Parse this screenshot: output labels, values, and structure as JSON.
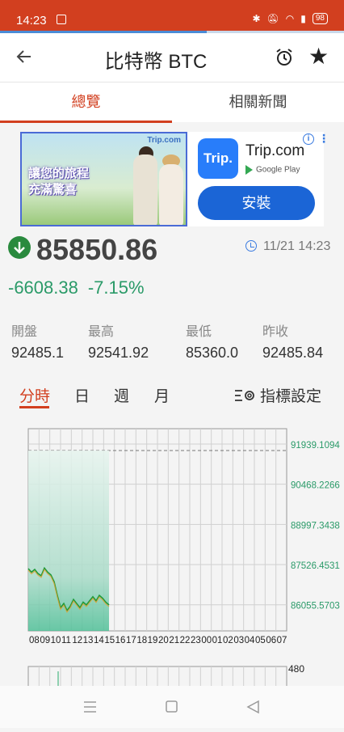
{
  "status_bar": {
    "time": "14:23",
    "battery": "98"
  },
  "header": {
    "title": "比特幣 BTC"
  },
  "tabs": [
    {
      "label": "總覽"
    },
    {
      "label": "相關新聞"
    }
  ],
  "ad": {
    "banner_brand": "Trip.com",
    "banner_headline": "讓您的旅程 充滿驚喜",
    "logo_text": "Trip.",
    "advertiser": "Trip.com",
    "store": "Google Play",
    "install_label": "安裝"
  },
  "quote": {
    "price": "85850.86",
    "datetime": "11/21 14:23",
    "change": "-6608.38",
    "change_pct": "-7.15%",
    "direction": "down"
  },
  "stats": [
    {
      "label": "開盤",
      "value": "92485.1"
    },
    {
      "label": "最高",
      "value": "92541.92"
    },
    {
      "label": "最低",
      "value": "85360.0"
    },
    {
      "label": "昨收",
      "value": "92485.84"
    }
  ],
  "period_tabs": [
    {
      "label": "分時"
    },
    {
      "label": "日"
    },
    {
      "label": "週"
    },
    {
      "label": "月"
    }
  ],
  "indicator_label": "指標設定",
  "colors": {
    "accent": "#d23f1f",
    "down": "#2a9a68",
    "link": "#3a7be0"
  },
  "chart_data": {
    "type": "area",
    "x_tick_labels": [
      "08",
      "09",
      "10",
      "11",
      "12",
      "13",
      "14",
      "15",
      "16",
      "17",
      "18",
      "19",
      "20",
      "21",
      "22",
      "23",
      "00",
      "01",
      "02",
      "03",
      "04",
      "05",
      "06",
      "07"
    ],
    "y_tick_labels": [
      "91939.1094",
      "90468.2266",
      "88997.3438",
      "87526.4531",
      "86055.5703"
    ],
    "ylim": [
      85100,
      92500
    ],
    "x": [
      0,
      0.3,
      0.6,
      0.9,
      1.2,
      1.5,
      1.8,
      2.1,
      2.4,
      2.7,
      3.0,
      3.3,
      3.6,
      3.9,
      4.2,
      4.5,
      4.8,
      5.1,
      5.4,
      5.7,
      6.0,
      6.3,
      6.6,
      6.9,
      7.2,
      7.5
    ],
    "series": [
      {
        "values": [
          87380,
          87250,
          87350,
          87200,
          87120,
          87400,
          87250,
          87150,
          86900,
          86400,
          85950,
          86100,
          85850,
          86000,
          86250,
          86100,
          85950,
          86150,
          86050,
          86200,
          86350,
          86200,
          86400,
          86300,
          86150,
          86050
        ]
      }
    ],
    "volume_label": "480"
  }
}
